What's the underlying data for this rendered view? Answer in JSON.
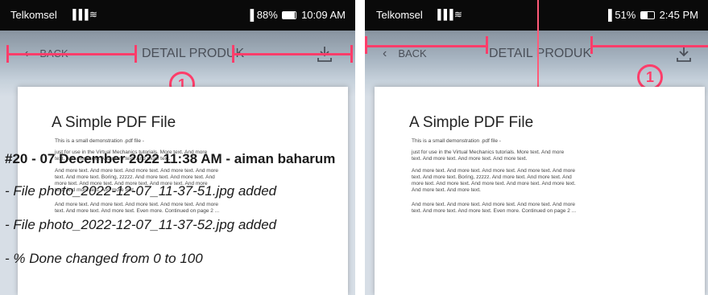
{
  "left": {
    "status": {
      "carrier": "Telkomsel",
      "signal": "▐▐▐ ≋",
      "right": "▐ 88% ",
      "time": "10:09 AM",
      "battery_level": 0.88
    },
    "appbar": {
      "back": "BACK",
      "title": "DETAIL PRODUK"
    },
    "annotation_number": "1",
    "doc": {
      "title": "A Simple PDF File",
      "lines": [
        "This is a small demonstration .pdf file -",
        "just for use in the Virtual Mechanics tutorials. More text. And more",
        "text. And more text. And more text. And more text.",
        "And more text. And more text. And more text. And more text. And more",
        "text. And more text. Boring, zzzzz. And more text. And more text. And",
        "more text. And more text. And more text. And more text. And more",
        "text. And more text. And more text.",
        "And more text. And more text. And more text. And more text. And more",
        "text. And more text. And more text. Even more. Continued on page 2 ..."
      ]
    }
  },
  "right": {
    "status": {
      "carrier": "Telkomsel",
      "signal": "▐▐▐ ≋",
      "right": "▐ 51% ",
      "time": "2:45 PM",
      "battery_level": 0.51
    },
    "appbar": {
      "back": "BACK",
      "title": "DETAIL PRODUK"
    },
    "annotation_number": "1",
    "doc": {
      "title": "A Simple PDF File",
      "lines": [
        "This is a small demonstration .pdf file -",
        "just for use in the Virtual Mechanics tutorials. More text. And more",
        "text. And more text. And more text. And more text.",
        "And more text. And more text. And more text. And more text. And more",
        "text. And more text. Boring, zzzzz. And more text. And more text. And",
        "more text. And more text. And more text. And more text. And more text.",
        "And more text. And more text.",
        "And more text. And more text. And more text. And more text. And more",
        "text. And more text. And more text. Even more. Continued on page 2 ..."
      ]
    }
  },
  "overlay": {
    "heading": "#20 - 07 December 2022 11:38 AM - aiman baharum",
    "items": [
      "- File photo_2022-12-07_11-37-51.jpg added",
      "- File photo_2022-12-07_11-37-52.jpg added",
      "- % Done changed from 0 to 100"
    ]
  }
}
